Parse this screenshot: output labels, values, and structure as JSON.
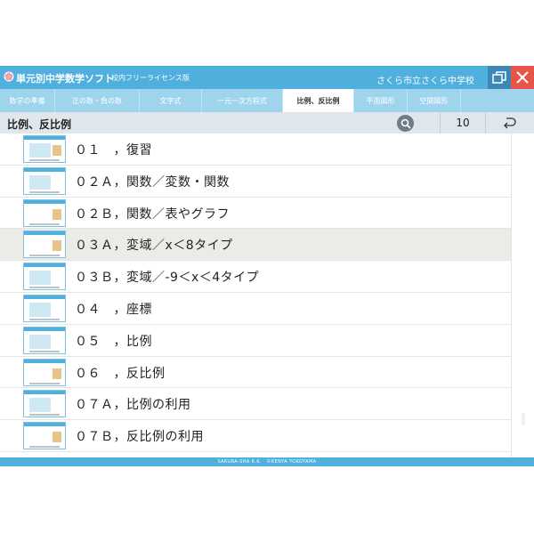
{
  "window": {
    "title": "単元別中学数学ソフト",
    "license": "校内フリーライセンス版",
    "school": "さくら市立さくら中学校",
    "restore_icon": "restore-window-icon",
    "close_icon": "close-icon"
  },
  "tabs": [
    {
      "label": "数学の準備"
    },
    {
      "label": "正の数・負の数"
    },
    {
      "label": "文字式"
    },
    {
      "label": "一元一次方程式"
    },
    {
      "label": "比例、反比例",
      "active": true
    },
    {
      "label": "平面図形"
    },
    {
      "label": "空間図形"
    }
  ],
  "header": {
    "title": "比例、反比例",
    "search_icon": "search-icon",
    "count": "10",
    "return_icon": "return-icon"
  },
  "lessons": [
    {
      "label": "０１　，復習"
    },
    {
      "label": "０２Ａ，関数／変数・関数"
    },
    {
      "label": "０２Ｂ，関数／表やグラフ"
    },
    {
      "label": "０３Ａ，変域／x＜8タイプ",
      "selected": true
    },
    {
      "label": "０３Ｂ，変域／-9＜x＜4タイプ"
    },
    {
      "label": "０４　，座標"
    },
    {
      "label": "０５　，比例"
    },
    {
      "label": "０６　，反比例"
    },
    {
      "label": "０７Ａ，比例の利用"
    },
    {
      "label": "０７Ｂ，反比例の利用"
    }
  ],
  "footer": {
    "text": "SAKURA-SHA K.K.　©KENYA YOKOYAMA"
  },
  "colors": {
    "primary": "#4fb0dd",
    "tab_bar": "#9fd5ec",
    "close": "#e8534a",
    "selected_row": "#ebebe8"
  }
}
